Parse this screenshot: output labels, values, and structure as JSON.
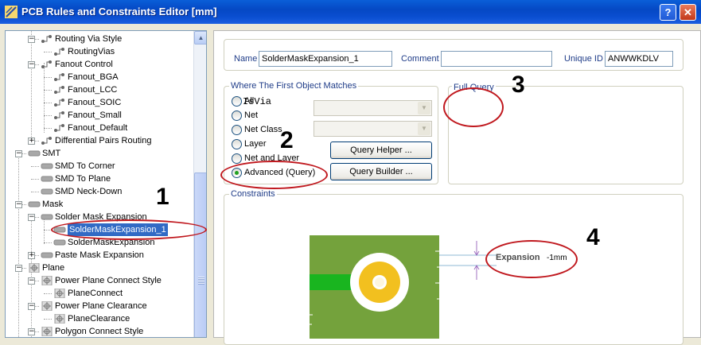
{
  "window": {
    "title": "PCB Rules and Constraints Editor [mm]",
    "help_btn": "?",
    "close_btn": "✕"
  },
  "tree": {
    "items": [
      {
        "label": "Routing Via Style"
      },
      {
        "label": "RoutingVias"
      },
      {
        "label": "Fanout Control"
      },
      {
        "label": "Fanout_BGA"
      },
      {
        "label": "Fanout_LCC"
      },
      {
        "label": "Fanout_SOIC"
      },
      {
        "label": "Fanout_Small"
      },
      {
        "label": "Fanout_Default"
      },
      {
        "label": "Differential Pairs Routing"
      },
      {
        "label": "SMT"
      },
      {
        "label": "SMD To Corner"
      },
      {
        "label": "SMD To Plane"
      },
      {
        "label": "SMD Neck-Down"
      },
      {
        "label": "Mask"
      },
      {
        "label": "Solder Mask Expansion"
      },
      {
        "label": "SolderMaskExpansion_1"
      },
      {
        "label": "SolderMaskExpansion"
      },
      {
        "label": "Paste Mask Expansion"
      },
      {
        "label": "Plane"
      },
      {
        "label": "Power Plane Connect Style"
      },
      {
        "label": "PlaneConnect"
      },
      {
        "label": "Power Plane Clearance"
      },
      {
        "label": "PlaneClearance"
      },
      {
        "label": "Polygon Connect Style"
      }
    ],
    "expand_minus": "−",
    "expand_plus": "+",
    "scroll_up": "▲"
  },
  "rule": {
    "name_label": "Name",
    "name_value": "SolderMaskExpansion_1",
    "comment_label": "Comment",
    "comment_value": "",
    "uid_label": "Unique ID",
    "uid_value": "ANWWKDLV"
  },
  "where": {
    "title": "Where The First Object Matches",
    "options": [
      "All",
      "Net",
      "Net Class",
      "Layer",
      "Net and Layer",
      "Advanced (Query)"
    ],
    "selected": "Advanced (Query)",
    "query_helper": "Query Helper ...",
    "query_builder": "Query Builder ..."
  },
  "full_query": {
    "title": "Full Query",
    "text": "IsVia"
  },
  "constraints": {
    "title": "Constraints",
    "expansion_label": "Expansion",
    "expansion_value": "-1mm"
  },
  "annotations": {
    "n1": "1",
    "n2": "2",
    "n3": "3",
    "n4": "4"
  },
  "colors": {
    "title_bar": "#0548c4",
    "selection": "#316ac5",
    "annotation": "#c0181e",
    "board_green": "#74a23c",
    "pad_yellow": "#f2c01f"
  }
}
